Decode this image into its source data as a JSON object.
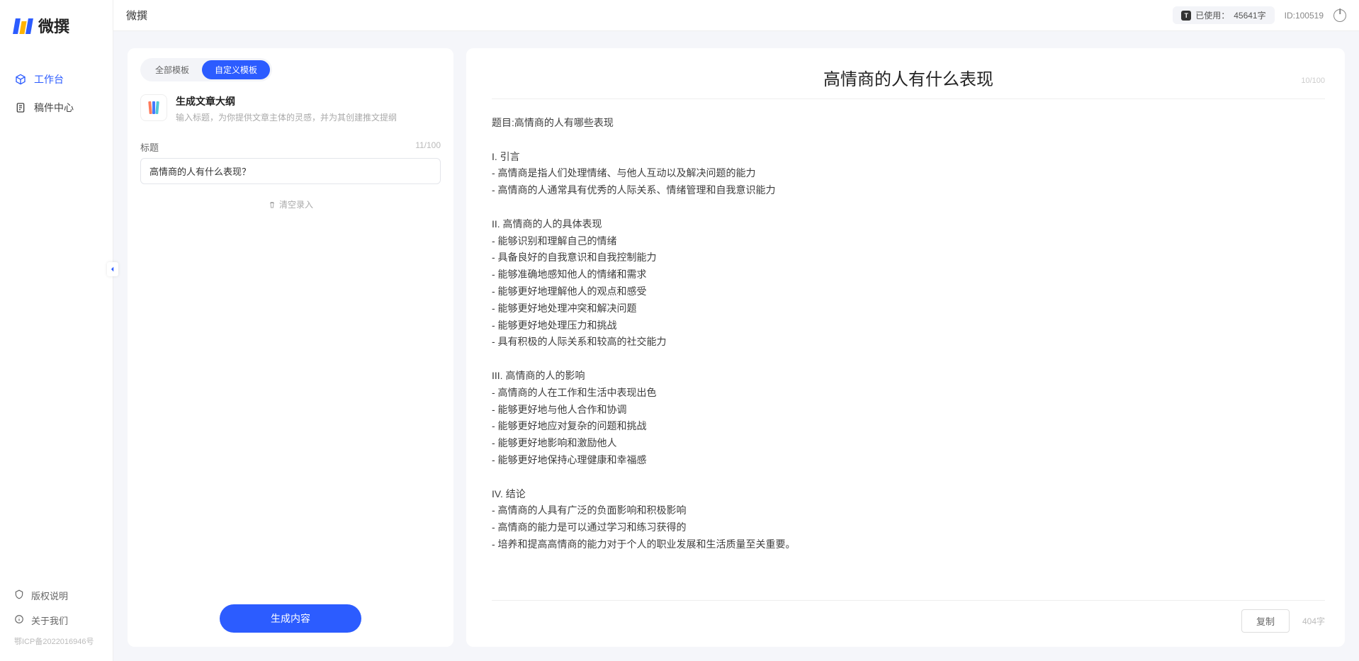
{
  "app": {
    "name": "微撰"
  },
  "topbar": {
    "usage_label": "已使用：",
    "usage_value": "45641字",
    "id_label": "ID:",
    "id_value": "100519"
  },
  "sidebar": {
    "nav": [
      {
        "label": "工作台",
        "active": true
      },
      {
        "label": "稿件中心",
        "active": false
      }
    ],
    "footer": [
      {
        "label": "版权说明"
      },
      {
        "label": "关于我们"
      }
    ],
    "icp": "鄂ICP备2022016946号"
  },
  "leftPanel": {
    "tabs": [
      {
        "label": "全部模板",
        "active": false
      },
      {
        "label": "自定义模板",
        "active": true
      }
    ],
    "template": {
      "title": "生成文章大纲",
      "desc": "输入标题，为你提供文章主体的灵感，并为其创建推文提纲"
    },
    "field": {
      "label": "标题",
      "value": "高情商的人有什么表现？",
      "counter": "11/100"
    },
    "clear": "清空录入",
    "generate": "生成内容"
  },
  "output": {
    "title": "高情商的人有什么表现",
    "counter": "10/100",
    "body": "题目:高情商的人有哪些表现\n\nI. 引言\n- 高情商是指人们处理情绪、与他人互动以及解决问题的能力\n- 高情商的人通常具有优秀的人际关系、情绪管理和自我意识能力\n\nII. 高情商的人的具体表现\n- 能够识别和理解自己的情绪\n- 具备良好的自我意识和自我控制能力\n- 能够准确地感知他人的情绪和需求\n- 能够更好地理解他人的观点和感受\n- 能够更好地处理冲突和解决问题\n- 能够更好地处理压力和挑战\n- 具有积极的人际关系和较高的社交能力\n\nIII. 高情商的人的影响\n- 高情商的人在工作和生活中表现出色\n- 能够更好地与他人合作和协调\n- 能够更好地应对复杂的问题和挑战\n- 能够更好地影响和激励他人\n- 能够更好地保持心理健康和幸福感\n\nIV. 结论\n- 高情商的人具有广泛的负面影响和积极影响\n- 高情商的能力是可以通过学习和练习获得的\n- 培养和提高高情商的能力对于个人的职业发展和生活质量至关重要。",
    "copy": "复制",
    "word_count": "404字"
  }
}
